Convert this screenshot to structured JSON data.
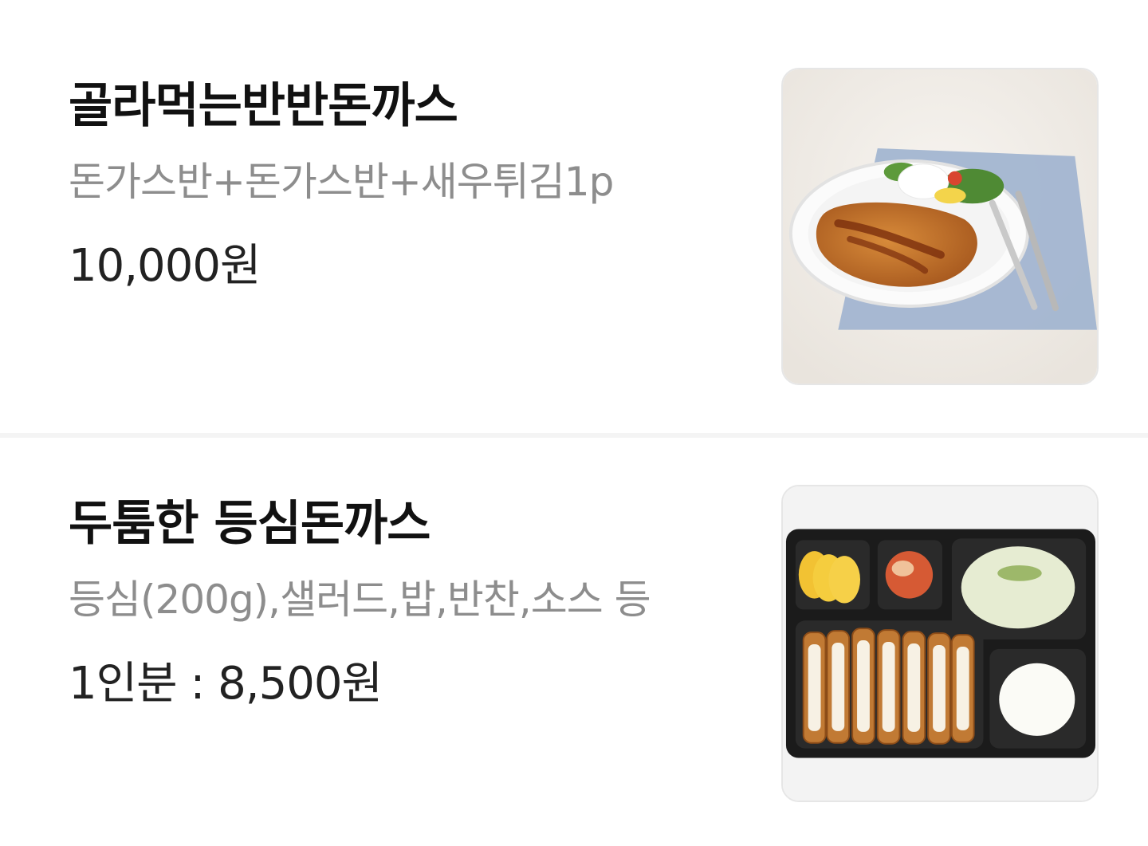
{
  "menu": {
    "items": [
      {
        "name": "골라먹는반반돈까스",
        "description": "돈가스반+돈가스반+새우튀김1p",
        "price": "10,000원",
        "image_icon": "pork-cutlet-plate-photo"
      },
      {
        "name": "두툼한 등심돈까스",
        "description": "등심(200g),샐러드,밥,반찬,소스 등",
        "price": "1인분 : 8,500원",
        "image_icon": "pork-cutlet-lunchbox-photo"
      }
    ]
  },
  "colors": {
    "title": "#111111",
    "description": "#8d8d8d",
    "price": "#222222",
    "divider": "#f4f4f4",
    "thumb_border": "#e6e6e6"
  }
}
